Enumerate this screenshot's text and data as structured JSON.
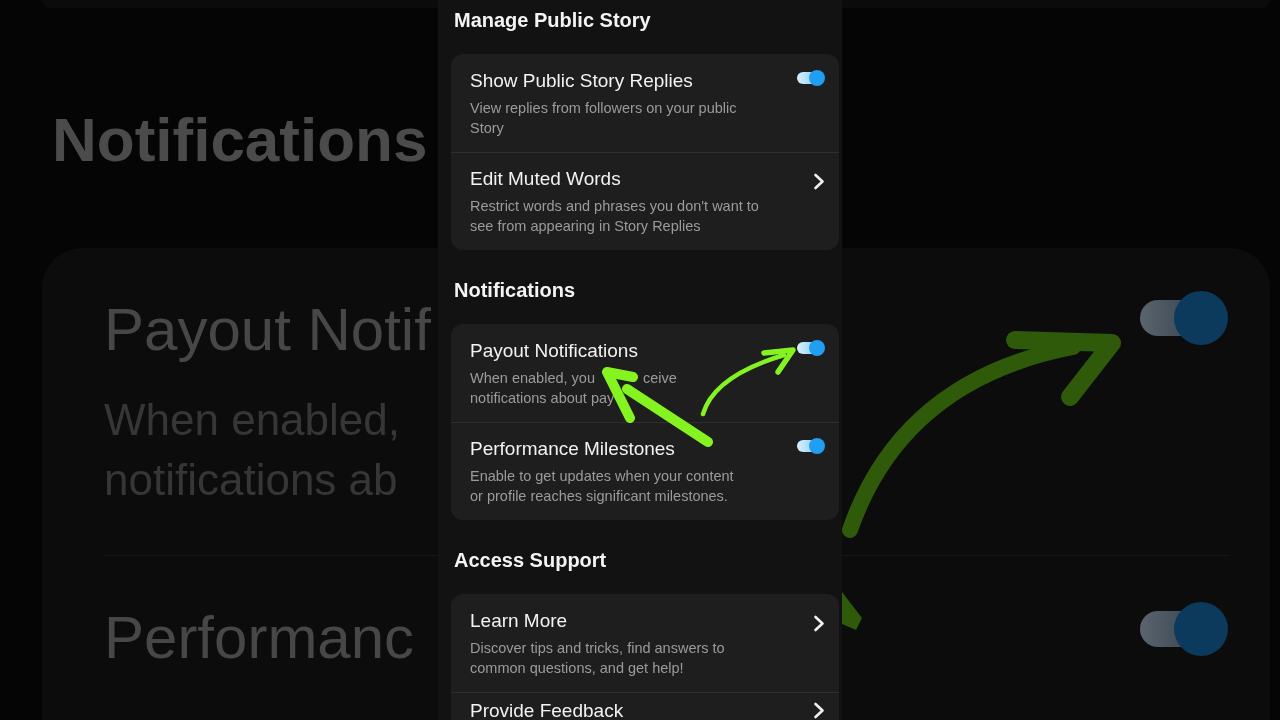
{
  "backdrop": {
    "heading": "Notifications",
    "items": [
      {
        "title": "Payout Notif",
        "description_lines": [
          "When enabled,",
          "notifications ab"
        ],
        "on": true
      },
      {
        "title": "Performanc",
        "on": true
      }
    ]
  },
  "sections": [
    {
      "title": "Manage Public Story",
      "rows": [
        {
          "kind": "toggle",
          "title": "Show Public Story Replies",
          "description_lines": [
            [
              "View replies from followers on your public"
            ],
            [
              "Story"
            ]
          ],
          "on": true
        },
        {
          "kind": "link",
          "title": "Edit Muted Words",
          "description_lines": [
            [
              "Restrict words and phrases you don't want to"
            ],
            [
              "see from appearing in Story Replies"
            ]
          ]
        }
      ]
    },
    {
      "title": "Notifications",
      "rows": [
        {
          "kind": "toggle",
          "title": "Payout Notifications",
          "description_lines": [
            [
              "When enabled, you",
              "ceive"
            ],
            [
              "notifications about pay"
            ]
          ],
          "on": true
        },
        {
          "kind": "toggle",
          "title": "Performance Milestones",
          "description_lines": [
            [
              "Enable to get updates when your content"
            ],
            [
              "or profile reaches significant milestones."
            ]
          ],
          "on": true
        }
      ]
    },
    {
      "title": "Access Support",
      "rows": [
        {
          "kind": "link",
          "title": "Learn More",
          "description_lines": [
            [
              "Discover tips and tricks, find answers to"
            ],
            [
              "common questions, and get help!"
            ]
          ]
        },
        {
          "kind": "link",
          "title": "Provide Feedback"
        }
      ]
    }
  ]
}
